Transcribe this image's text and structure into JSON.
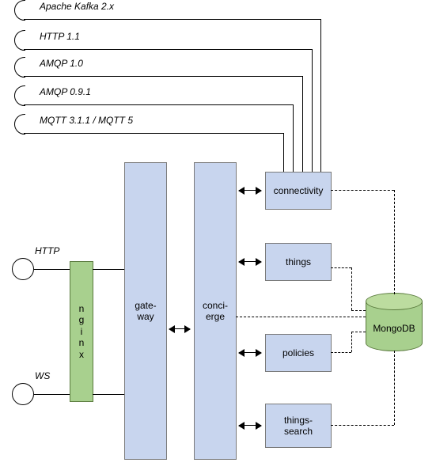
{
  "protocols": {
    "p0": "Apache Kafka 2.x",
    "p1": "HTTP 1.1",
    "p2": "AMQP 1.0",
    "p3": "AMQP 0.9.1",
    "p4": "MQTT  3.1.1 / MQTT 5"
  },
  "left": {
    "http": "HTTP",
    "ws": "WS"
  },
  "components": {
    "nginx": "n\ng\ni\nn\nx",
    "gateway": "gate-\nway",
    "concierge": "conci-\nerge",
    "connectivity": "connectivity",
    "things": "things",
    "policies": "policies",
    "thingsSearch": "things-\nsearch"
  },
  "db": "MongoDB"
}
